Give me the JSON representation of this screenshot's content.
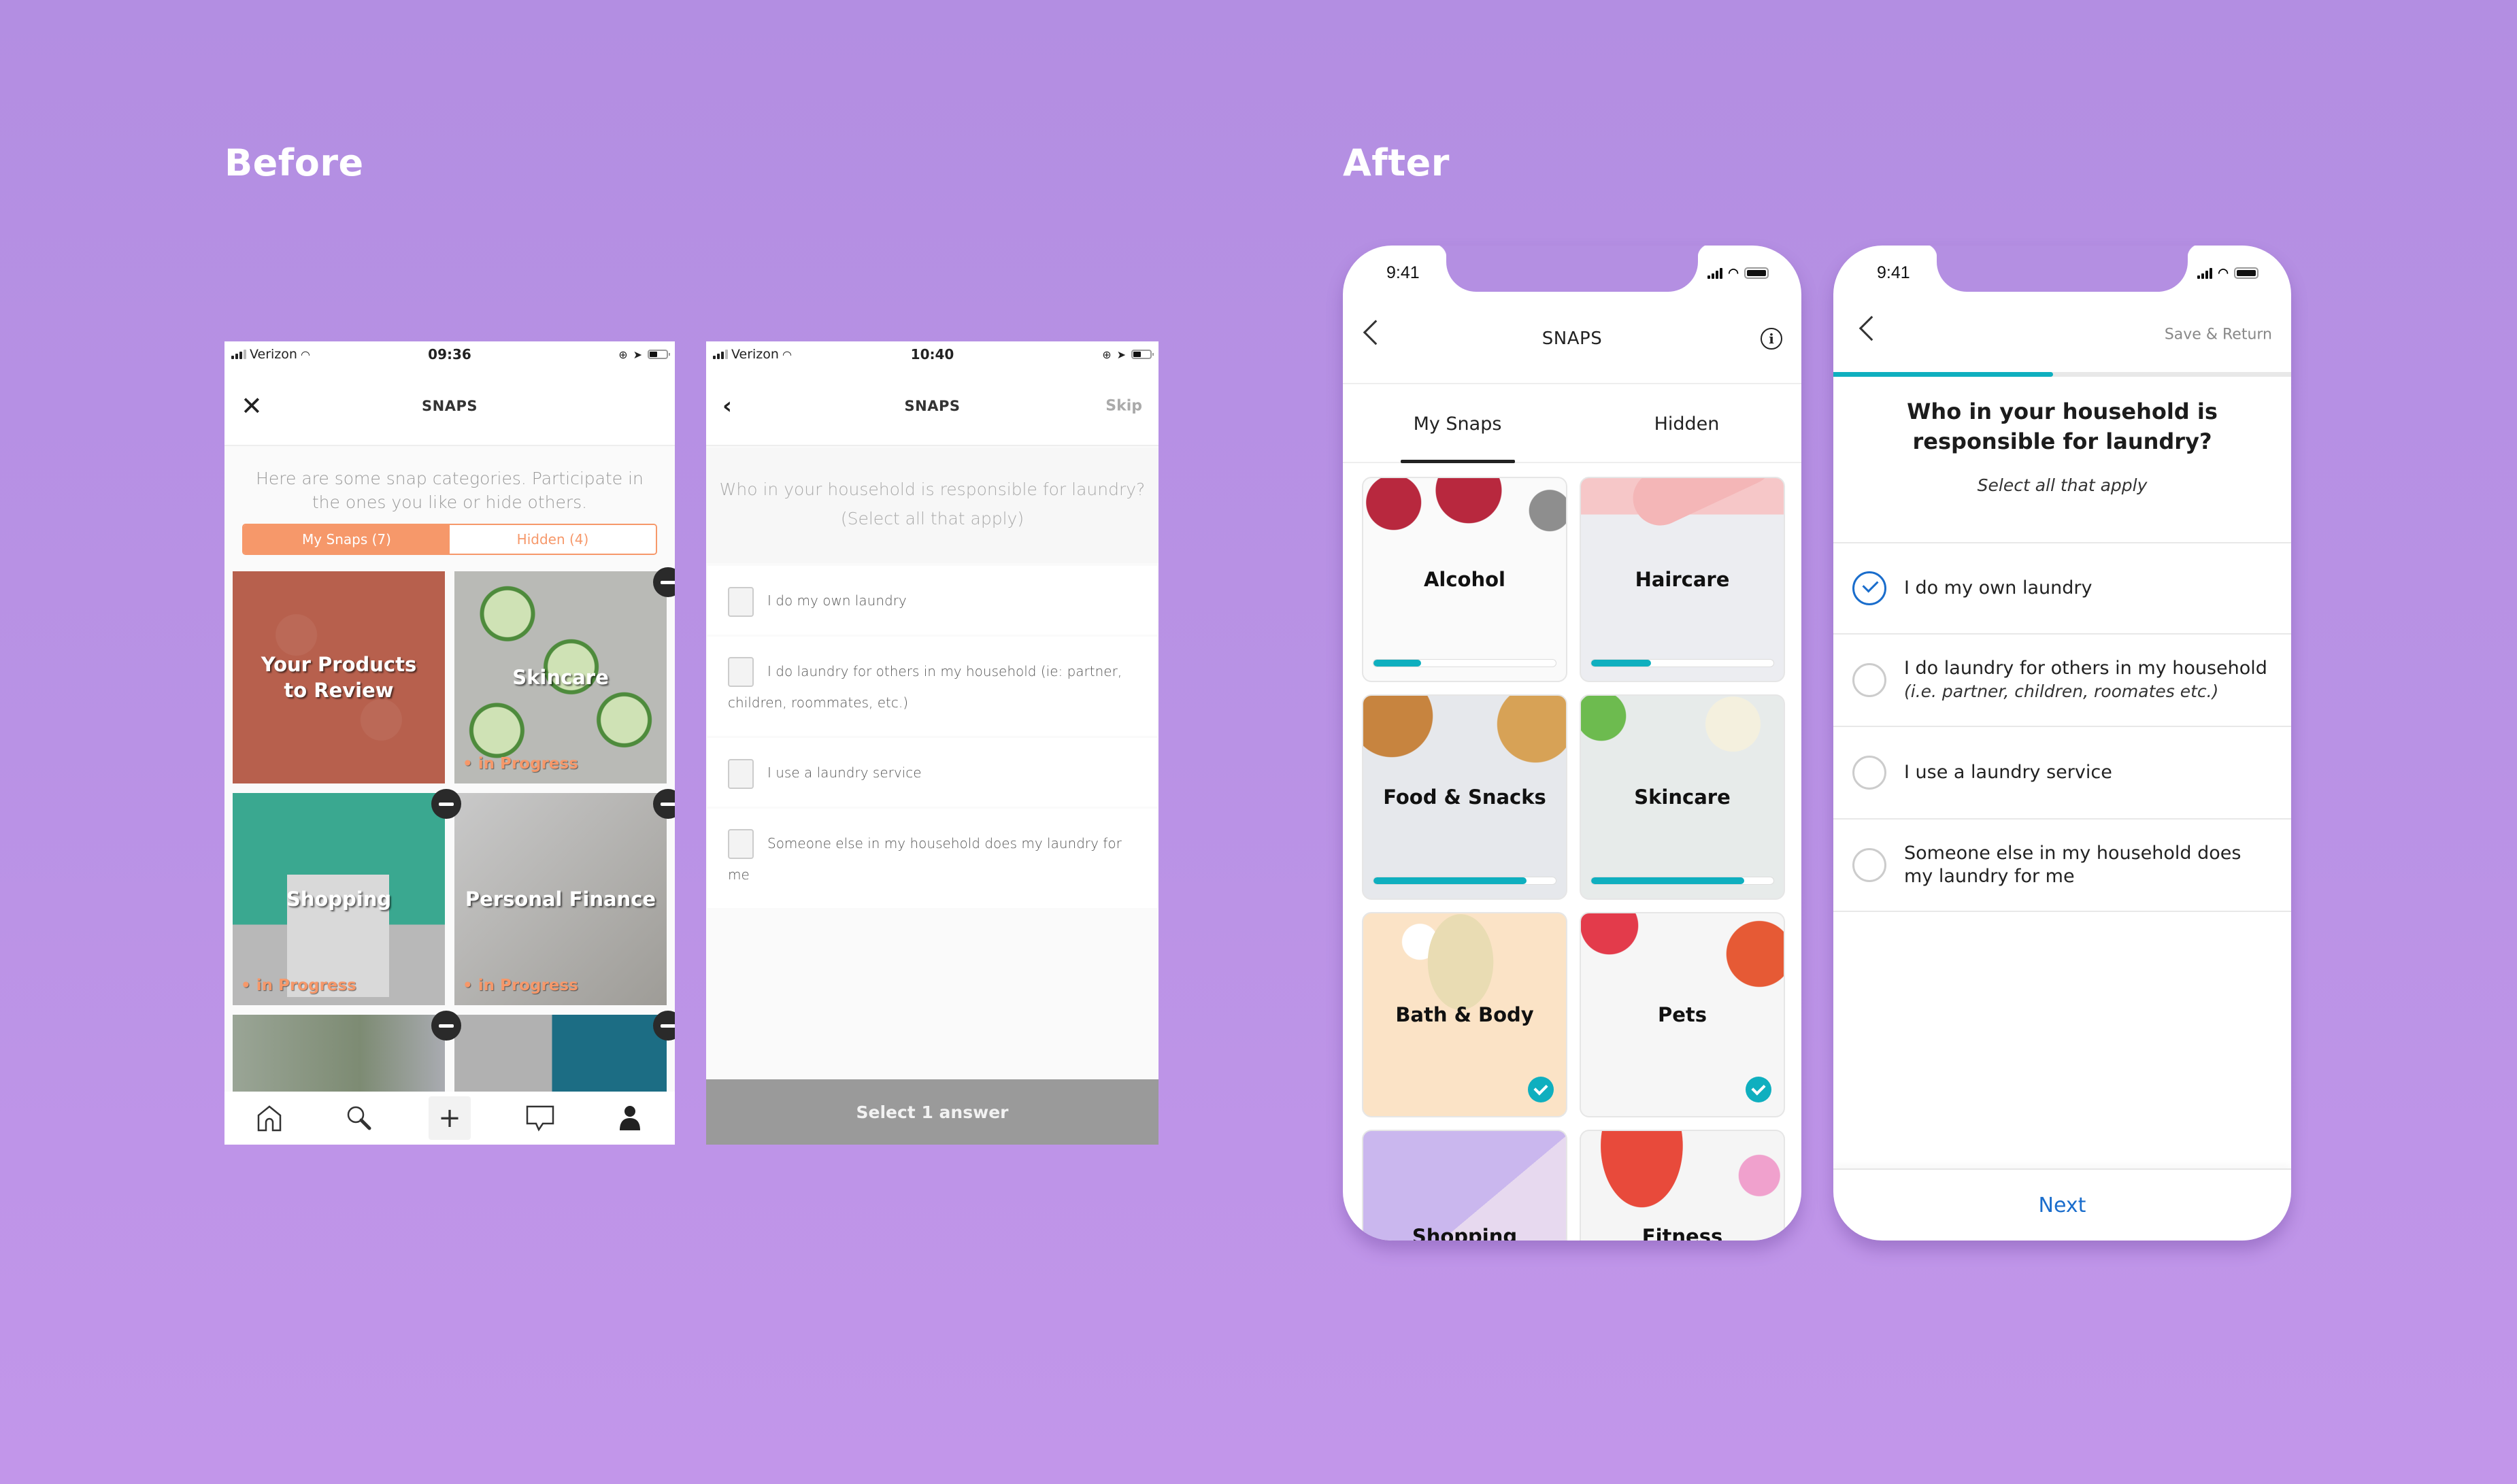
{
  "labels": {
    "before": "Before",
    "after": "After"
  },
  "colors": {
    "background": "#B48FE2",
    "orange_accent": "#F6986A",
    "teal_accent": "#0FAFBF",
    "blue_accent": "#1A6DCC"
  },
  "before1": {
    "status": {
      "carrier": "Verizon",
      "time": "09:36"
    },
    "nav": {
      "title": "SNAPS",
      "left_icon": "close-icon"
    },
    "intro": "Here are some snap categories. Participate in the ones you like or hide others.",
    "segments": [
      {
        "label": "My Snaps (7)",
        "active": true
      },
      {
        "label": "Hidden (4)",
        "active": false
      }
    ],
    "tiles": [
      {
        "label": "Your Products\nto Review",
        "status": ""
      },
      {
        "label": "Skincare",
        "status": "• in Progress"
      },
      {
        "label": "Shopping",
        "status": "• in Progress"
      },
      {
        "label": "Personal Finance",
        "status": "• in Progress"
      },
      {
        "label": "",
        "status": ""
      },
      {
        "label": "",
        "status": ""
      }
    ],
    "tabbar": [
      "home-icon",
      "search-icon",
      "plus-icon",
      "chat-icon",
      "profile-icon"
    ],
    "tabbar_plus": "+"
  },
  "before2": {
    "status": {
      "carrier": "Verizon",
      "time": "10:40"
    },
    "nav": {
      "title": "SNAPS",
      "right": "Skip"
    },
    "question": "Who in your household is responsible for laundry? (Select all that apply)",
    "options": [
      "I do my own laundry",
      "I do laundry for others in my household (ie: partner, children, roommates, etc.)",
      "I use a laundry service",
      "Someone else in my household does my laundry for me"
    ],
    "submit": "Select 1 answer"
  },
  "after1": {
    "status": {
      "time": "9:41"
    },
    "nav": {
      "title": "SNAPS",
      "info": "i"
    },
    "tabs": [
      {
        "label": "My Snaps",
        "active": true
      },
      {
        "label": "Hidden",
        "active": false
      }
    ],
    "cards": [
      {
        "label": "Alcohol",
        "progress": 0.26,
        "done": false
      },
      {
        "label": "Haircare",
        "progress": 0.33,
        "done": false
      },
      {
        "label": "Food & Snacks",
        "progress": 0.84,
        "done": false
      },
      {
        "label": "Skincare",
        "progress": 0.84,
        "done": false
      },
      {
        "label": "Bath & Body",
        "progress": null,
        "done": true
      },
      {
        "label": "Pets",
        "progress": null,
        "done": true
      },
      {
        "label": "Shopping",
        "progress": null,
        "done": false
      },
      {
        "label": "Fitness",
        "progress": null,
        "done": false
      }
    ]
  },
  "after2": {
    "status": {
      "time": "9:41"
    },
    "nav": {
      "right": "Save & Return"
    },
    "survey_progress": 0.48,
    "question": "Who in your household is responsible for laundry?",
    "subtitle": "Select all that apply",
    "options": [
      {
        "label": "I do my own laundry",
        "sub": "",
        "selected": true
      },
      {
        "label": "I do laundry for others in my household",
        "sub": "(i.e. partner, children, roomates etc.)",
        "selected": false
      },
      {
        "label": "I use a laundry service",
        "sub": "",
        "selected": false
      },
      {
        "label": "Someone else in my household does my laundry for me",
        "sub": "",
        "selected": false
      }
    ],
    "next": "Next"
  }
}
